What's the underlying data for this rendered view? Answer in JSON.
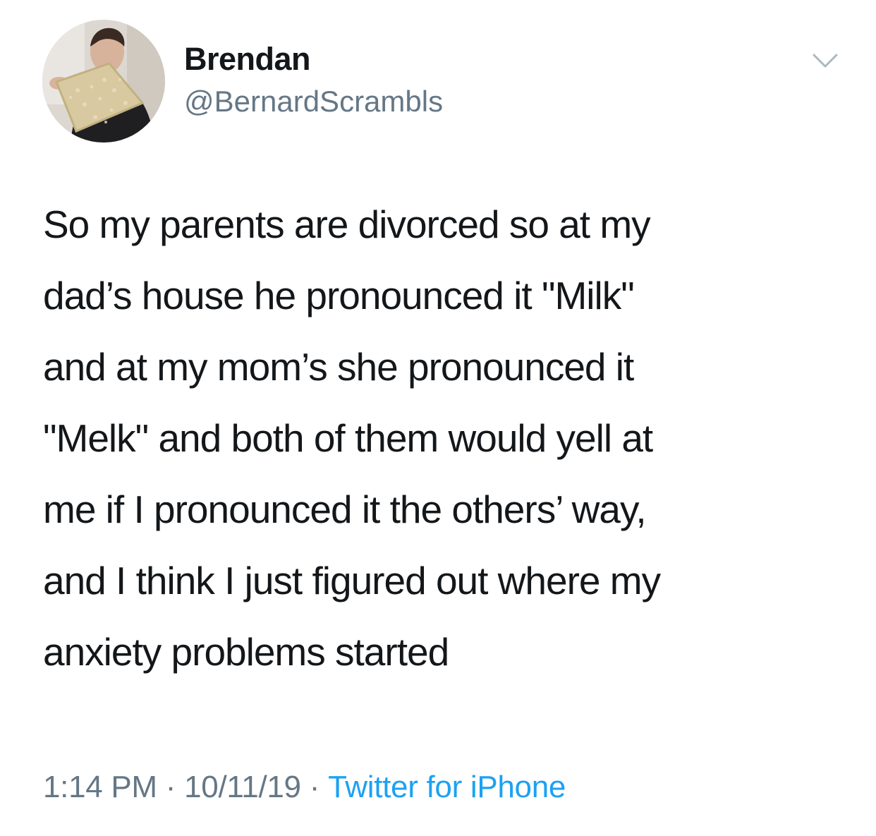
{
  "author": {
    "display_name": "Brendan",
    "handle": "@BernardScrambls",
    "avatar_icon": "profile-photo"
  },
  "menu": {
    "icon": "chevron-down-icon"
  },
  "tweet": {
    "lines": [
      "So my parents are divorced so at my",
      "dad’s house he pronounced it \"Milk\"",
      "and at my mom’s she pronounced it",
      "\"Melk\" and both of them would yell at",
      "me if I pronounced it the others’ way,",
      "and I think I just figured out where my",
      "anxiety problems started"
    ]
  },
  "meta": {
    "time": "1:14 PM",
    "separator": "·",
    "date": "10/11/19",
    "source": "Twitter for iPhone"
  },
  "colors": {
    "text": "#14171a",
    "secondary": "#657786",
    "link": "#1da1f2",
    "background": "#ffffff"
  }
}
